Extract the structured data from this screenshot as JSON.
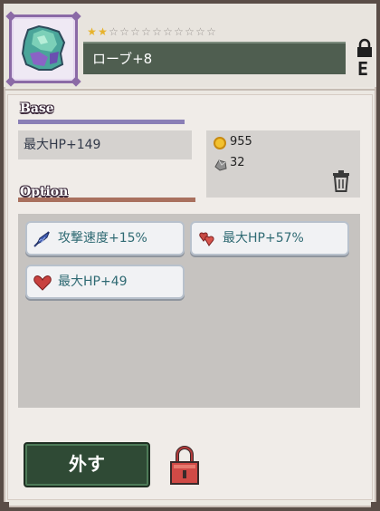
{
  "item": {
    "name": "ローブ+8",
    "stars_filled": 2,
    "stars_total": 12,
    "equipped_mark": "E",
    "icon": "robe-icon"
  },
  "base": {
    "label": "Base",
    "stat": "最大HP+149"
  },
  "price": {
    "gold": "955",
    "ore": "32"
  },
  "option": {
    "label": "Option",
    "items": [
      {
        "text": "攻撃速度+15%",
        "icon": "feather-icon"
      },
      {
        "text": "最大HP+57%",
        "icon": "double-heart-icon"
      },
      {
        "text": "最大HP+49",
        "icon": "heart-icon"
      }
    ]
  },
  "actions": {
    "unequip_label": "外す"
  },
  "colors": {
    "frame": "#5a4d47",
    "namebar": "#4f5e50",
    "option_text": "#2f6a73",
    "unequip_bg": "#2f4a35",
    "star_on": "#e7b32c"
  }
}
